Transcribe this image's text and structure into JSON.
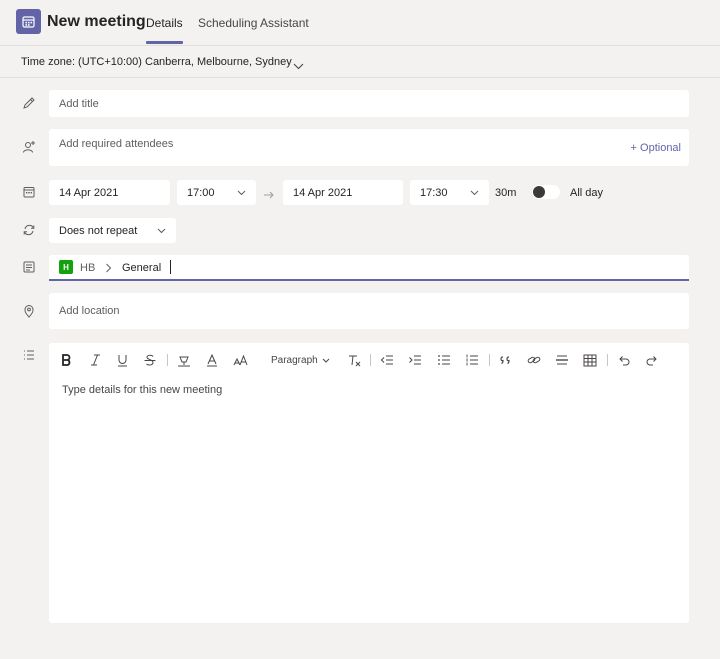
{
  "header": {
    "title": "New meeting",
    "tabs": [
      {
        "label": "Details",
        "active": true
      },
      {
        "label": "Scheduling Assistant",
        "active": false
      }
    ]
  },
  "timezone": {
    "label": "Time zone: (UTC+10:00) Canberra, Melbourne, Sydney"
  },
  "form": {
    "title_placeholder": "Add title",
    "attendees_placeholder": "Add required attendees",
    "optional_label": "+ Optional",
    "start_date": "14 Apr 2021",
    "start_time": "17:00",
    "end_date": "14 Apr 2021",
    "end_time": "17:30",
    "duration": "30m",
    "all_day_label": "All day",
    "all_day_enabled": false,
    "repeat_value": "Does not repeat",
    "channel": {
      "team_initial": "H",
      "team_name": "HB",
      "channel_name": "General"
    },
    "location_placeholder": "Add location",
    "details_placeholder": "Type details for this new meeting"
  },
  "editor_toolbar": {
    "paragraph_label": "Paragraph",
    "icons": [
      "bold-icon",
      "italic-icon",
      "underline-icon",
      "strikethrough-icon",
      "highlight-icon",
      "font-color-icon",
      "font-size-icon",
      "clear-format-icon",
      "decrease-indent-icon",
      "increase-indent-icon",
      "bulleted-list-icon",
      "numbered-list-icon",
      "quote-icon",
      "link-icon",
      "horizontal-rule-icon",
      "table-icon",
      "undo-icon",
      "redo-icon"
    ]
  },
  "colors": {
    "accent": "#6264a7",
    "background": "#f3f2f1",
    "field": "#ffffff",
    "team_badge": "#13a10e"
  }
}
